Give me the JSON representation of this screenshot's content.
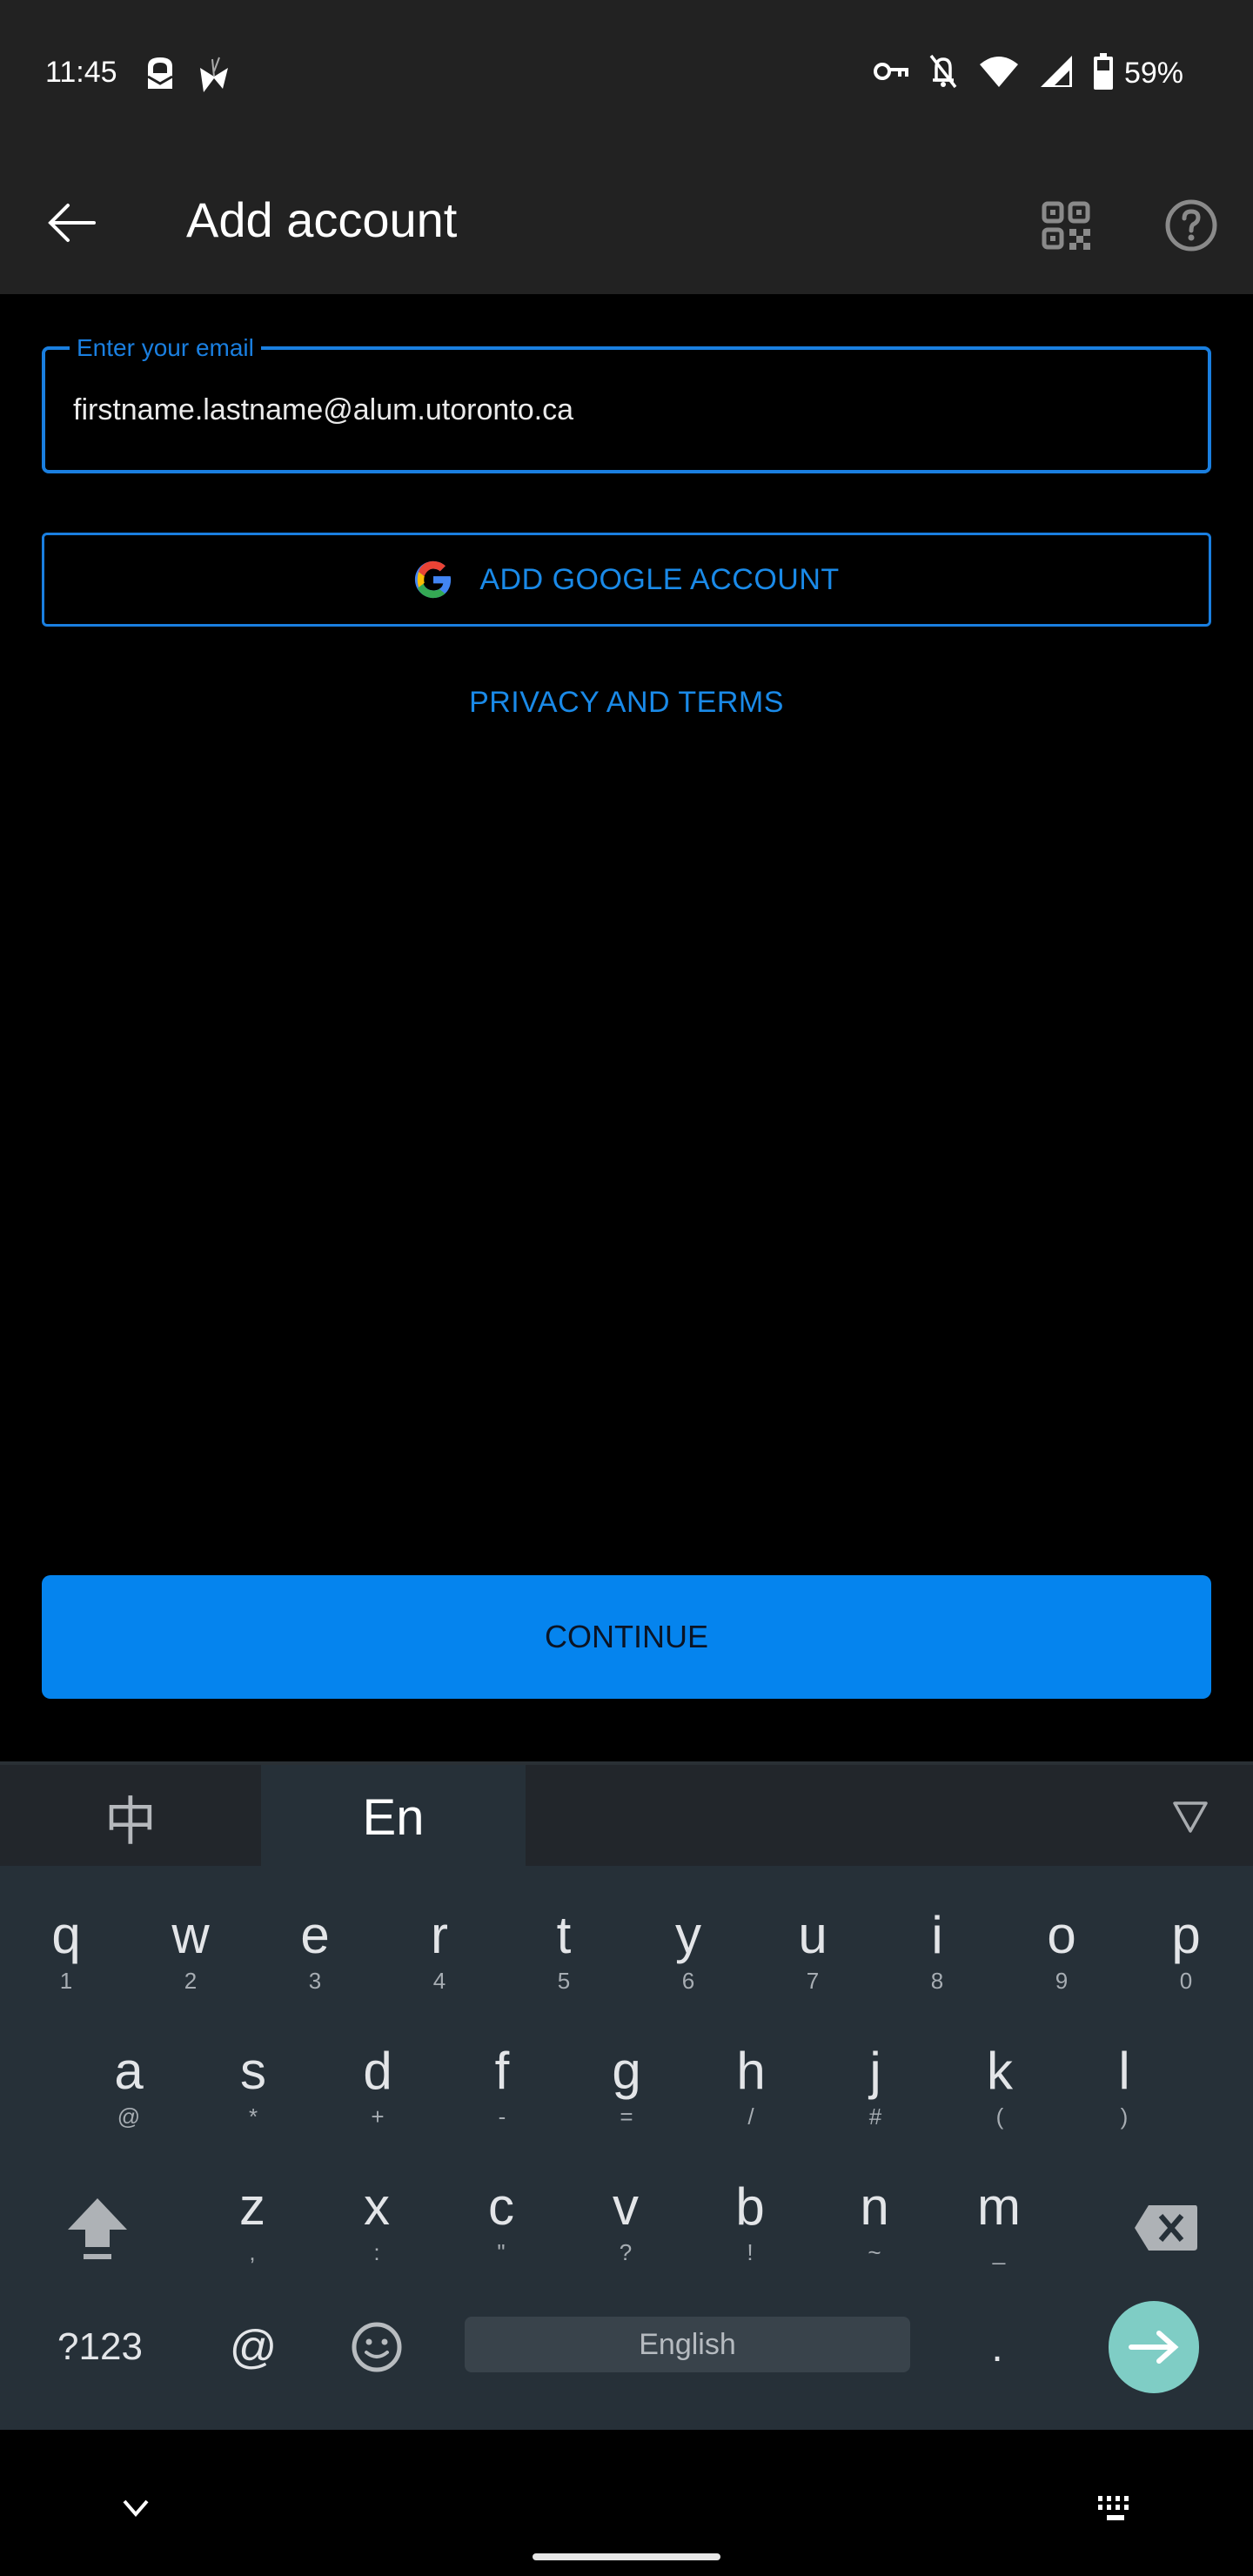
{
  "status_bar": {
    "time": "11:45",
    "left_icons": [
      "proton-mail-icon",
      "butterfly-app-icon"
    ],
    "right_icons": [
      "vpn-key-icon",
      "notifications-off-icon",
      "wifi-icon",
      "cell-signal-icon",
      "battery-icon"
    ],
    "battery_percent": "59%"
  },
  "app_bar": {
    "title": "Add account",
    "back_icon": "arrow-back-icon",
    "actions": [
      "qr-code-icon",
      "help-icon"
    ]
  },
  "form": {
    "email_label": "Enter your email",
    "email_value": "firstname.lastname@alum.utoronto.ca",
    "google_button_label": "ADD GOOGLE ACCOUNT",
    "privacy_link": "PRIVACY AND TERMS",
    "continue_label": "CONTINUE"
  },
  "colors": {
    "accent": "#1a7fe0",
    "continue_bg": "#0584ee",
    "app_bar_bg": "#222222",
    "keyboard_bg": "#263038",
    "enter_key": "#7fcdc5"
  },
  "keyboard": {
    "tabs": [
      {
        "label": "中",
        "active": false
      },
      {
        "label": "En",
        "active": true
      }
    ],
    "rows": [
      [
        {
          "key": "q",
          "sub": "1"
        },
        {
          "key": "w",
          "sub": "2"
        },
        {
          "key": "e",
          "sub": "3"
        },
        {
          "key": "r",
          "sub": "4"
        },
        {
          "key": "t",
          "sub": "5"
        },
        {
          "key": "y",
          "sub": "6"
        },
        {
          "key": "u",
          "sub": "7"
        },
        {
          "key": "i",
          "sub": "8"
        },
        {
          "key": "o",
          "sub": "9"
        },
        {
          "key": "p",
          "sub": "0"
        }
      ],
      [
        {
          "key": "a",
          "sub": "@"
        },
        {
          "key": "s",
          "sub": "*"
        },
        {
          "key": "d",
          "sub": "+"
        },
        {
          "key": "f",
          "sub": "-"
        },
        {
          "key": "g",
          "sub": "="
        },
        {
          "key": "h",
          "sub": "/"
        },
        {
          "key": "j",
          "sub": "#"
        },
        {
          "key": "k",
          "sub": "("
        },
        {
          "key": "l",
          "sub": ")"
        }
      ],
      [
        {
          "key": "z",
          "sub": ","
        },
        {
          "key": "x",
          "sub": ":"
        },
        {
          "key": "c",
          "sub": "\""
        },
        {
          "key": "v",
          "sub": "?"
        },
        {
          "key": "b",
          "sub": "!"
        },
        {
          "key": "n",
          "sub": "~"
        },
        {
          "key": "m",
          "sub": "_"
        }
      ]
    ],
    "symbols_key": "?123",
    "at_key": "@",
    "space_label": "English",
    "period_key": "."
  },
  "nav_bar": {
    "left_icon": "chevron-down-icon",
    "right_icon": "keyboard-switch-icon"
  }
}
